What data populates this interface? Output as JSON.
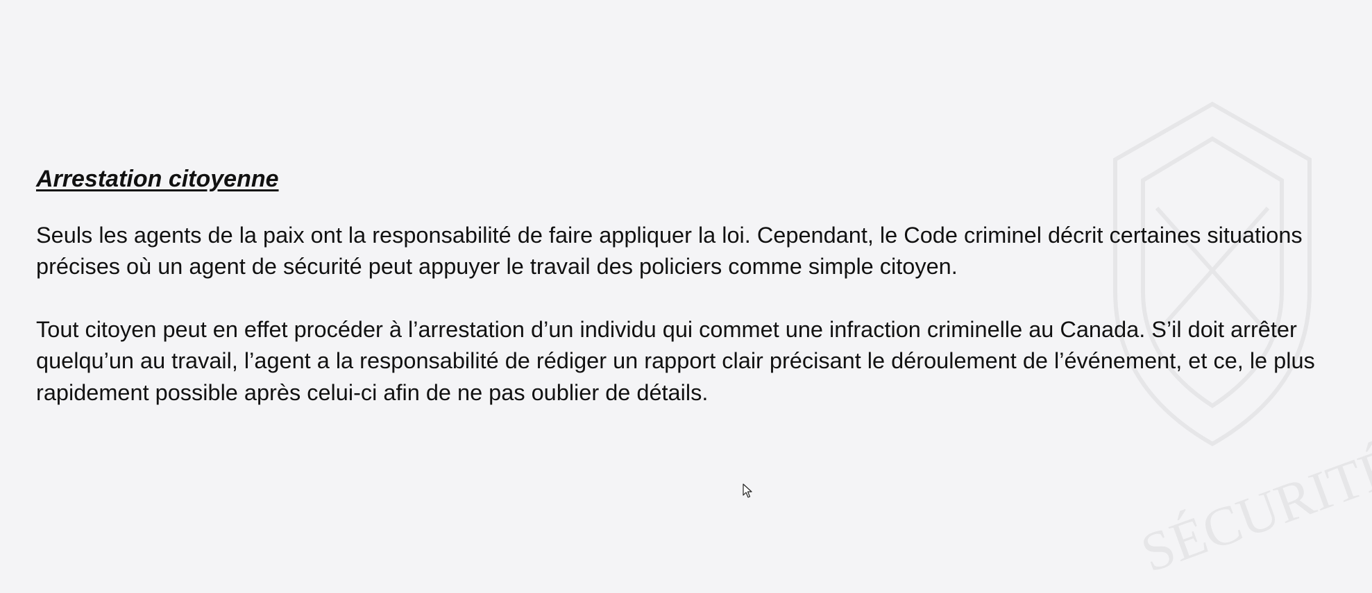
{
  "slide": {
    "title": "Arrestation citoyenne",
    "paragraphs": [
      "Seuls les agents de la paix ont la responsabilité de faire appliquer la loi. Cependant, le Code criminel décrit certaines situations précises où un agent de sécurité peut appuyer le travail des policiers comme simple citoyen.",
      "Tout citoyen peut en effet procéder à l’arrestation d’un individu qui commet une infraction criminelle au Canada. S’il doit arrêter quelqu’un au travail, l’agent a la responsabilité de rédiger un rapport clair précisant le déroulement de l’événement, et ce, le plus rapidement possible après celui-ci afin de ne pas oublier de détails."
    ],
    "watermark_text": "SÉCURITÉ"
  },
  "colors": {
    "background": "#f4f4f6",
    "text": "#111111"
  },
  "icons": {
    "cursor": "mouse-pointer-icon"
  }
}
